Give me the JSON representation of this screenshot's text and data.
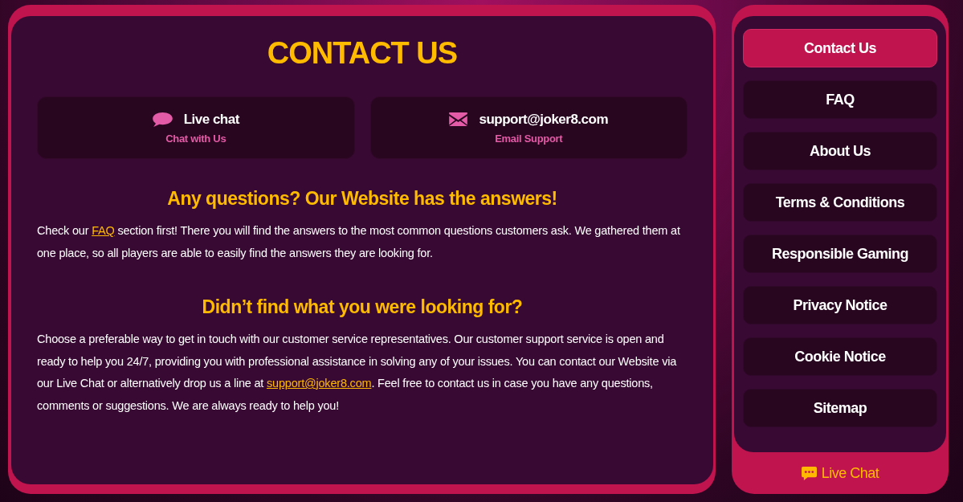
{
  "page": {
    "title": "CONTACT US"
  },
  "contact_cards": [
    {
      "kind": "chat",
      "label": "Live chat",
      "sublabel": "Chat with Us"
    },
    {
      "kind": "email",
      "label": "support@joker8.com",
      "sublabel": "Email Support"
    }
  ],
  "sections": [
    {
      "heading": "Any questions? Our Website has the answers!",
      "body": [
        {
          "kind": "text",
          "text": "Check our "
        },
        {
          "kind": "link",
          "text": "FAQ"
        },
        {
          "kind": "text",
          "text": " section first! There you will find the answers to the most common questions customers ask. We gathered them at one place, so all players are able to easily find the answers they are looking for."
        }
      ]
    },
    {
      "heading": "Didn’t find what you were looking for?",
      "body": [
        {
          "kind": "text",
          "text": "Choose a preferable way to get in touch with our customer service representatives. Our customer support service is open and ready to help you 24/7, providing you with professional assistance in solving any of your issues. You can contact our Website via our Live Chat or alternatively drop us a line at "
        },
        {
          "kind": "link",
          "text": "support@joker8.com"
        },
        {
          "kind": "text",
          "text": ". Feel free to contact us in case you have any questions, comments or suggestions. We are always ready to help you!"
        }
      ]
    }
  ],
  "sidebar": {
    "items": [
      {
        "label": "Contact Us",
        "selected": true
      },
      {
        "label": "FAQ",
        "selected": false
      },
      {
        "label": "About Us",
        "selected": false
      },
      {
        "label": "Terms & Conditions",
        "selected": false
      },
      {
        "label": "Responsible Gaming",
        "selected": false
      },
      {
        "label": "Privacy Notice",
        "selected": false
      },
      {
        "label": "Cookie Notice",
        "selected": false
      },
      {
        "label": "Sitemap",
        "selected": false
      }
    ],
    "live_chat": {
      "label": "Live Chat"
    }
  }
}
